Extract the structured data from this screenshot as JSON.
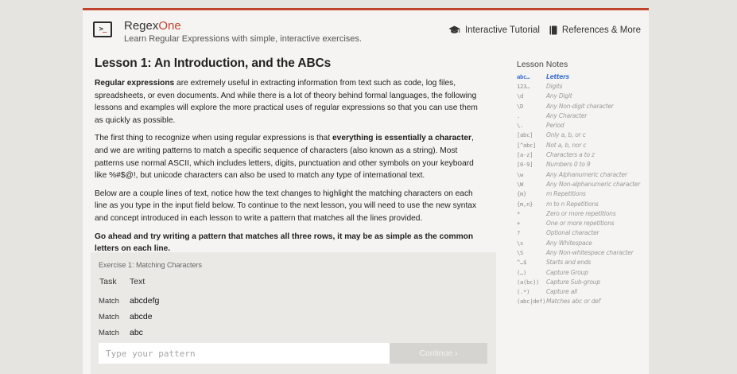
{
  "header": {
    "logo_glyph": ">",
    "logo_cursor": "_",
    "brand_prefix": "Regex",
    "brand_suffix": "One",
    "tagline": "Learn Regular Expressions with simple, interactive exercises.",
    "nav": [
      {
        "label": "Interactive Tutorial",
        "icon": "graduation-cap-icon"
      },
      {
        "label": "References & More",
        "icon": "book-icon"
      }
    ]
  },
  "lesson": {
    "title": "Lesson 1: An Introduction, and the ABCs",
    "p1_bold": "Regular expressions",
    "p1_rest": " are extremely useful in extracting information from text such as code, log files, spreadsheets, or even documents. And while there is a lot of theory behind formal languages, the following lessons and examples will explore the more practical uses of regular expressions so that you can use them as quickly as possible.",
    "p2_a": "The first thing to recognize when using regular expressions is that ",
    "p2_bold": "everything is essentially a character",
    "p2_b": ", and we are writing patterns to match a specific sequence of characters (also known as a string). Most patterns use normal ASCII, which includes letters, digits, punctuation and other symbols on your keyboard like %#$@!, but unicode characters can also be used to match any type of international text.",
    "p3": "Below are a couple lines of text, notice how the text changes to highlight the matching characters on each line as you type in the input field below. To continue to the next lesson, you will need to use the new syntax and concept introduced in each lesson to write a pattern that matches all the lines provided.",
    "p4_a": "Go ahead and try writing a pattern that matches all three rows, ",
    "p4_bold": "it may be as simple as the common letters on each line."
  },
  "exercise": {
    "title": "Exercise 1: Matching Characters",
    "col_task": "Task",
    "col_text": "Text",
    "rows": [
      {
        "task": "Match",
        "text": "abcdefg"
      },
      {
        "task": "Match",
        "text": "abcde"
      },
      {
        "task": "Match",
        "text": "abc"
      }
    ],
    "input_placeholder": "Type your pattern",
    "continue_label": "Continue ›"
  },
  "notes": {
    "title": "Lesson Notes",
    "active_index": 0,
    "items": [
      {
        "sym": "abc…",
        "desc": "Letters"
      },
      {
        "sym": "123…",
        "desc": "Digits"
      },
      {
        "sym": "\\d",
        "desc": "Any Digit"
      },
      {
        "sym": "\\D",
        "desc": "Any Non-digit character"
      },
      {
        "sym": ".",
        "desc": "Any Character"
      },
      {
        "sym": "\\.",
        "desc": "Period"
      },
      {
        "sym": "[abc]",
        "desc": "Only a, b, or c"
      },
      {
        "sym": "[^abc]",
        "desc": "Not a, b, nor c"
      },
      {
        "sym": "[a-z]",
        "desc": "Characters a to z"
      },
      {
        "sym": "[0-9]",
        "desc": "Numbers 0 to 9"
      },
      {
        "sym": "\\w",
        "desc": "Any Alphanumeric character"
      },
      {
        "sym": "\\W",
        "desc": "Any Non-alphanumeric character"
      },
      {
        "sym": "{m}",
        "desc": "m Repetitions"
      },
      {
        "sym": "{m,n}",
        "desc": "m to n Repetitions"
      },
      {
        "sym": "*",
        "desc": "Zero or more repetitions"
      },
      {
        "sym": "+",
        "desc": "One or more repetitions"
      },
      {
        "sym": "?",
        "desc": "Optional character"
      },
      {
        "sym": "\\s",
        "desc": "Any Whitespace"
      },
      {
        "sym": "\\S",
        "desc": "Any Non-whitespace character"
      },
      {
        "sym": "^…$",
        "desc": "Starts and ends"
      },
      {
        "sym": "(…)",
        "desc": "Capture Group"
      },
      {
        "sym": "(a(bc))",
        "desc": "Capture Sub-group"
      },
      {
        "sym": "(.*)",
        "desc": "Capture all"
      },
      {
        "sym": "(abc|def)",
        "desc": "Matches abc or def"
      }
    ]
  },
  "colors": {
    "accent": "#c0432e",
    "active_note": "#3a6fcf",
    "page_bg": "#f5f4f2",
    "outer_bg": "#e6e4e1"
  }
}
